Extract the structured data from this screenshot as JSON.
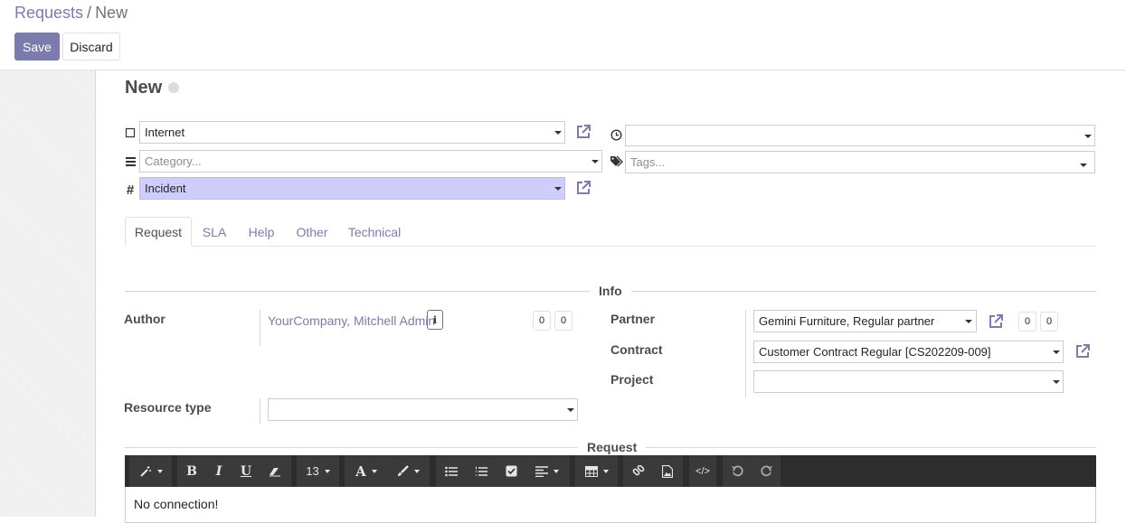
{
  "breadcrumb": {
    "parent": "Requests",
    "separator": "/",
    "current": "New"
  },
  "toolbar": {
    "save_label": "Save",
    "discard_label": "Discard"
  },
  "form": {
    "title": "New",
    "type": {
      "value": "Internet",
      "icon": "square-outline-icon"
    },
    "category": {
      "placeholder": "Category...",
      "icon": "bars-icon"
    },
    "kind": {
      "value": "Incident",
      "icon": "hashtag-icon"
    },
    "deadline": {
      "value": "",
      "icon": "clock-icon"
    },
    "tags": {
      "placeholder": "Tags...",
      "icon": "tags-icon"
    }
  },
  "tabs": [
    {
      "label": "Request",
      "active": true
    },
    {
      "label": "SLA",
      "active": false
    },
    {
      "label": "Help",
      "active": false
    },
    {
      "label": "Other",
      "active": false
    },
    {
      "label": "Technical",
      "active": false
    }
  ],
  "info": {
    "section_label": "Info",
    "author_label": "Author",
    "author_value": "YourCompany, Mitchell Admin",
    "author_counts": [
      "0",
      "0"
    ],
    "partner_label": "Partner",
    "partner_value": "Gemini Furniture, Regular partner",
    "partner_counts": [
      "0",
      "0"
    ],
    "contract_label": "Contract",
    "contract_value": "Customer Contract Regular [CS202209-009]",
    "project_label": "Project",
    "project_value": "",
    "resource_type_label": "Resource type",
    "resource_type_value": ""
  },
  "request": {
    "section_label": "Request",
    "font_size": "13",
    "text": "No connection!"
  },
  "colors": {
    "accent": "#7c7bad",
    "highlight": "#cfcdfa",
    "toolbar_bg": "#2d2d2d"
  }
}
